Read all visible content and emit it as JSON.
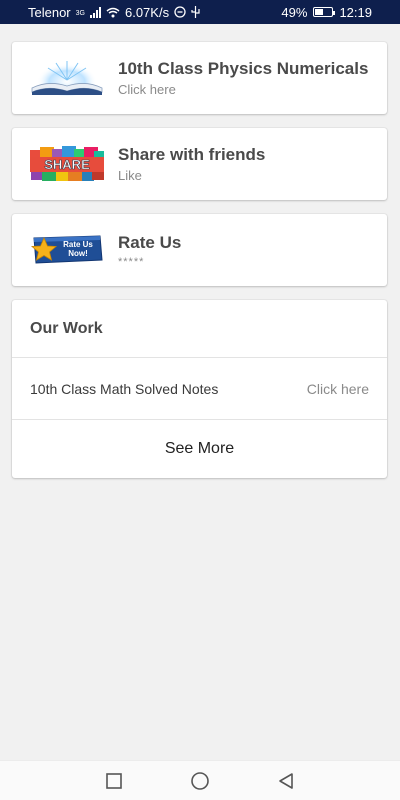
{
  "status_bar": {
    "carrier": "Telenor",
    "network_type": "3G",
    "speed": "6.07K/s",
    "battery": "49%",
    "battery_level": 0.49,
    "time": "12:19"
  },
  "cards": [
    {
      "title": "10th Class Physics Numericals",
      "subtitle": "Click here",
      "icon": "open-book-icon"
    },
    {
      "title": "Share with friends",
      "subtitle": "Like",
      "icon": "share-banner-icon"
    },
    {
      "title": "Rate Us",
      "subtitle": "*****",
      "icon": "rate-us-now-icon",
      "badge_text": [
        "Rate Us",
        "Now!"
      ]
    }
  ],
  "our_work": {
    "heading": "Our Work",
    "item_label": "10th Class Math Solved Notes",
    "item_link": "Click here",
    "see_more": "See More"
  },
  "share_text": "SHARE",
  "nav": [
    "recents-square-icon",
    "home-circle-icon",
    "back-triangle-icon"
  ],
  "colors": {
    "status_bar": "#0e1f4d",
    "background": "#f1f1f1",
    "card": "#ffffff",
    "title_text": "#4a4a4a",
    "subtitle_text": "#8a8a8a"
  }
}
